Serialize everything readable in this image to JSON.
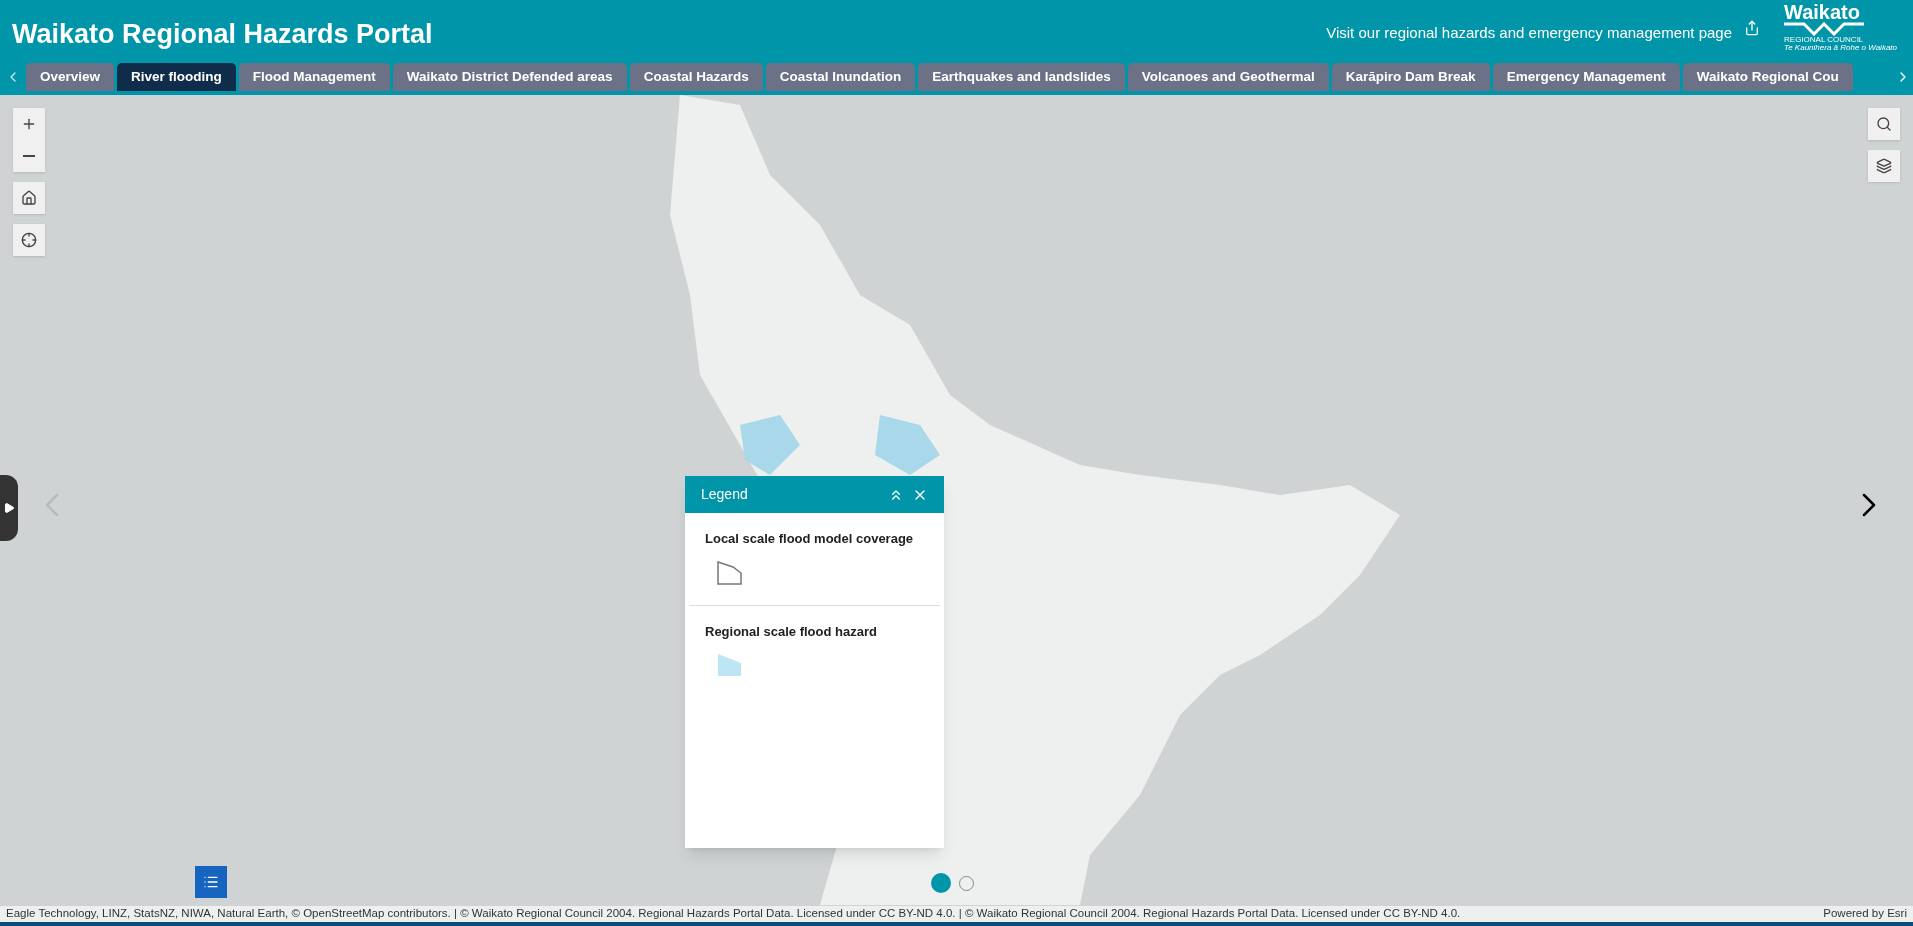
{
  "header": {
    "title": "Waikato Regional Hazards Portal",
    "link": "Visit our regional hazards and emergency management page",
    "logo": {
      "name": "Waikato",
      "line1": "REGIONAL COUNCIL",
      "line2": "Te Kaunihera ā Rohe o Waikato"
    }
  },
  "tabs": [
    {
      "label": "Overview",
      "selected": false
    },
    {
      "label": "River flooding",
      "selected": true
    },
    {
      "label": "Flood Management",
      "selected": false
    },
    {
      "label": "Waikato District Defended areas",
      "selected": false
    },
    {
      "label": "Coastal Hazards",
      "selected": false
    },
    {
      "label": "Coastal Inundation",
      "selected": false
    },
    {
      "label": "Earthquakes and landslides",
      "selected": false
    },
    {
      "label": "Volcanoes and Geothermal",
      "selected": false
    },
    {
      "label": "Karāpiro Dam Break",
      "selected": false
    },
    {
      "label": "Emergency Management",
      "selected": false
    },
    {
      "label": "Waikato Regional Cou",
      "selected": false
    }
  ],
  "map_nav": {
    "previous_disabled": true,
    "next_disabled": false
  },
  "legend": {
    "title": "Legend",
    "layers": [
      {
        "title": "Local scale flood model coverage",
        "kind": "outline"
      },
      {
        "title": "Regional scale flood hazard",
        "kind": "fill"
      }
    ]
  },
  "pages": [
    {
      "selected": true
    },
    {
      "selected": false
    }
  ],
  "footer": {
    "attribution": "Eagle Technology, LINZ, StatsNZ, NIWA, Natural Earth, © OpenStreetMap contributors. | © Waikato Regional Council 2004. Regional Hazards Portal Data. Licensed under CC BY-ND 4.0. | © Waikato Regional Council 2004. Regional Hazards Portal Data. Licensed under CC BY-ND 4.0.",
    "powered": "Powered by Esri"
  }
}
